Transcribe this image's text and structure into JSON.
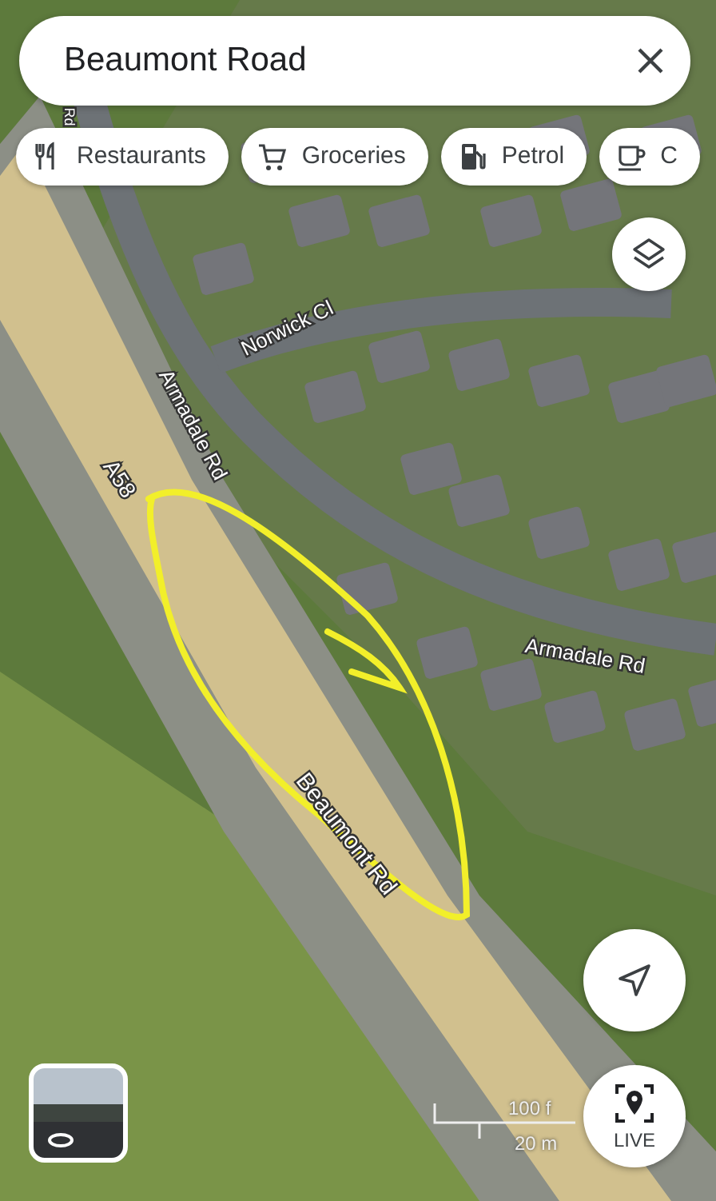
{
  "search": {
    "value": "Beaumont Road"
  },
  "chips": [
    {
      "kind": "restaurants",
      "label": "Restaurants"
    },
    {
      "kind": "groceries",
      "label": "Groceries"
    },
    {
      "kind": "petrol",
      "label": "Petrol"
    },
    {
      "kind": "cafe",
      "label": "C"
    }
  ],
  "road_labels": [
    {
      "text": "Rd"
    },
    {
      "text": "Norwick Cl"
    },
    {
      "text": "Armadale Rd"
    },
    {
      "text": "A58"
    },
    {
      "text": "Armadale Rd"
    },
    {
      "text": "Beaumont Rd"
    }
  ],
  "scale": {
    "imperial": "100 f",
    "metric": "20 m"
  },
  "live_button": {
    "label": "LIVE"
  }
}
